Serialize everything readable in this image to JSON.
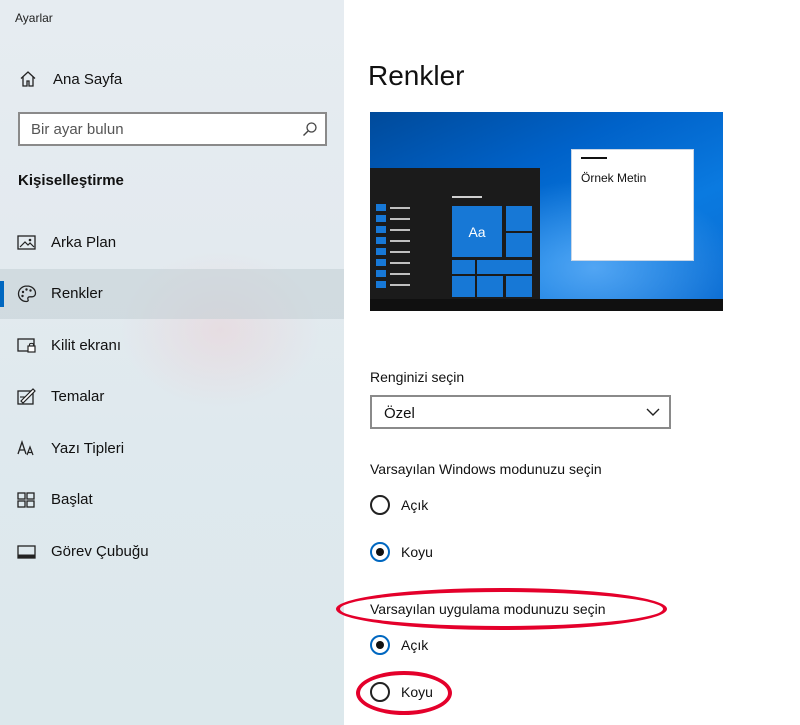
{
  "app": {
    "title": "Ayarlar"
  },
  "sidebar": {
    "home_label": "Ana Sayfa",
    "search": {
      "placeholder": "Bir ayar bulun"
    },
    "section_title": "Kişiselleştirme",
    "items": [
      {
        "label": "Arka Plan",
        "icon": "picture-icon",
        "active": false
      },
      {
        "label": "Renkler",
        "icon": "palette-icon",
        "active": true
      },
      {
        "label": "Kilit ekranı",
        "icon": "lock-screen-icon",
        "active": false
      },
      {
        "label": "Temalar",
        "icon": "themes-icon",
        "active": false
      },
      {
        "label": "Yazı Tipleri",
        "icon": "fonts-icon",
        "active": false
      },
      {
        "label": "Başlat",
        "icon": "start-icon",
        "active": false
      },
      {
        "label": "Görev Çubuğu",
        "icon": "taskbar-icon",
        "active": false
      }
    ]
  },
  "main": {
    "title": "Renkler",
    "preview": {
      "tile_text": "Aa",
      "sample_text": "Örnek Metin"
    },
    "color_select": {
      "label": "Renginizi seçin",
      "value": "Özel"
    },
    "windows_mode": {
      "label": "Varsayılan Windows modunuzu seçin",
      "options": [
        {
          "label": "Açık",
          "checked": false
        },
        {
          "label": "Koyu",
          "checked": true
        }
      ]
    },
    "app_mode": {
      "label": "Varsayılan uygulama modunuzu seçin",
      "options": [
        {
          "label": "Açık",
          "checked": true
        },
        {
          "label": "Koyu",
          "checked": false
        }
      ]
    }
  },
  "colors": {
    "accent": "#0067c0",
    "annotation": "#e4002b",
    "tile_blue": "#1778d6"
  }
}
